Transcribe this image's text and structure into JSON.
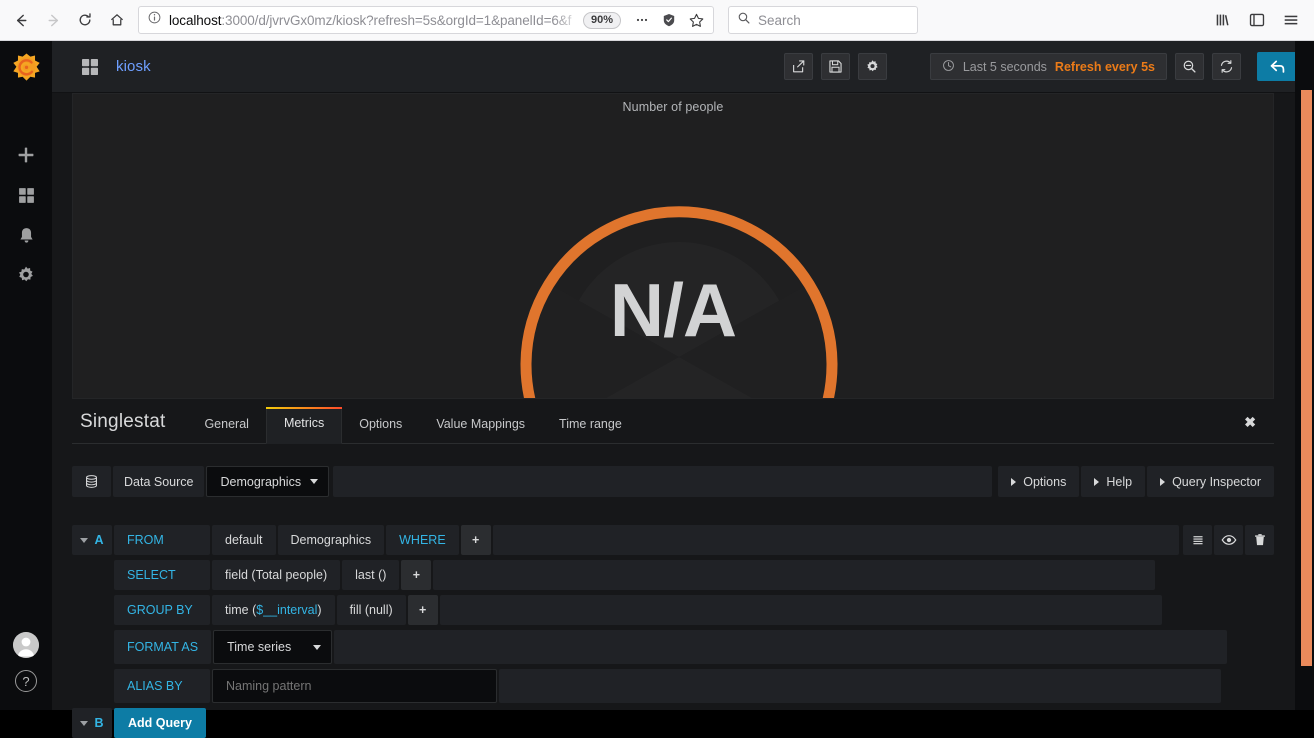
{
  "browser": {
    "url_bold": "localhost",
    "url_rest": ":3000/d/jvrvGx0mz/kiosk?refresh=5s&orgId=1&panelId=6&f",
    "zoom_level": "90%",
    "search_placeholder": "Search",
    "icons": {
      "back": "back-arrow-icon",
      "forward": "forward-arrow-icon",
      "reload": "reload-icon",
      "home": "home-icon",
      "info": "page-info-icon",
      "menu": "ellipsis-icon",
      "shield": "tracking-protection-icon",
      "bookmark": "star-icon",
      "library": "library-icon",
      "sidebar": "sidebar-icon",
      "hamburger": "app-menu-icon"
    }
  },
  "sidemenu": {
    "logo": "grafana-logo-icon",
    "items": [
      {
        "name": "create-icon",
        "title": "Create"
      },
      {
        "name": "dashboards-icon",
        "title": "Dashboards"
      },
      {
        "name": "alerting-bell-icon",
        "title": "Alerting"
      },
      {
        "name": "configuration-gear-icon",
        "title": "Configuration"
      }
    ],
    "bottom": [
      {
        "name": "user-avatar",
        "title": "User"
      },
      {
        "name": "help-icon",
        "title": "Help",
        "glyph": "?"
      }
    ]
  },
  "navbar": {
    "dashboard_icon": "dashboard-grid-icon",
    "title": "kiosk",
    "actions": [
      {
        "name": "share-dashboard-button",
        "icon": "share-icon"
      },
      {
        "name": "save-dashboard-button",
        "icon": "floppy-disk-icon"
      },
      {
        "name": "dashboard-settings-button",
        "icon": "gear-icon"
      }
    ],
    "timepicker": {
      "clock_icon": "clock-icon",
      "range": "Last 5 seconds",
      "refresh": "Refresh every 5s"
    },
    "zoom_out": "zoom-out-icon",
    "refresh": "refresh-icon",
    "back": "back-arrow-icon"
  },
  "panel": {
    "title": "Number of people",
    "value": "N/A",
    "gauge": {
      "arc_color": "#e0752d",
      "track_color": "#252525",
      "start_angle": -205,
      "end_angle": 25,
      "percent": 100
    }
  },
  "editor": {
    "panel_type": "Singlestat",
    "tabs": [
      {
        "label": "General",
        "active": false
      },
      {
        "label": "Metrics",
        "active": true
      },
      {
        "label": "Options",
        "active": false
      },
      {
        "label": "Value Mappings",
        "active": false
      },
      {
        "label": "Time range",
        "active": false
      }
    ],
    "close": "✖",
    "datasource": {
      "icon": "database-icon",
      "label": "Data Source",
      "value": "Demographics"
    },
    "right_buttons": [
      {
        "label": "Options"
      },
      {
        "label": "Help"
      },
      {
        "label": "Query Inspector"
      }
    ],
    "queries": [
      {
        "ref": "A",
        "rows": [
          {
            "keyword": "FROM",
            "segments": [
              "default",
              "Demographics",
              "WHERE"
            ],
            "keyword_segments": [
              2
            ],
            "plus": "+"
          },
          {
            "keyword": "SELECT",
            "segments": [
              "field (Total people)",
              "last ()"
            ],
            "plus": "+"
          },
          {
            "keyword": "GROUP BY",
            "segments": [
              "time ($__interval)",
              "fill (null)"
            ],
            "variable": "$__interval",
            "plus": "+"
          },
          {
            "keyword": "FORMAT AS",
            "select_value": "Time series"
          },
          {
            "keyword": "ALIAS BY",
            "input_placeholder": "Naming pattern",
            "input_value": ""
          }
        ],
        "row_icons": [
          {
            "name": "query-menu-icon",
            "glyph": "hamburger"
          },
          {
            "name": "toggle-visibility-eye-icon",
            "glyph": "eye"
          },
          {
            "name": "delete-query-trash-icon",
            "glyph": "trash"
          }
        ]
      },
      {
        "ref": "B",
        "add_query_label": "Add Query"
      }
    ]
  },
  "colors": {
    "accent_orange": "#eb7b18",
    "link_blue": "#33b5e5",
    "button_blue": "#0d7ca5",
    "gauge_orange": "#e0752d",
    "panel_bg": "#1f1f20",
    "app_bg": "#161719",
    "scrollbar": "#ea8a5b"
  }
}
